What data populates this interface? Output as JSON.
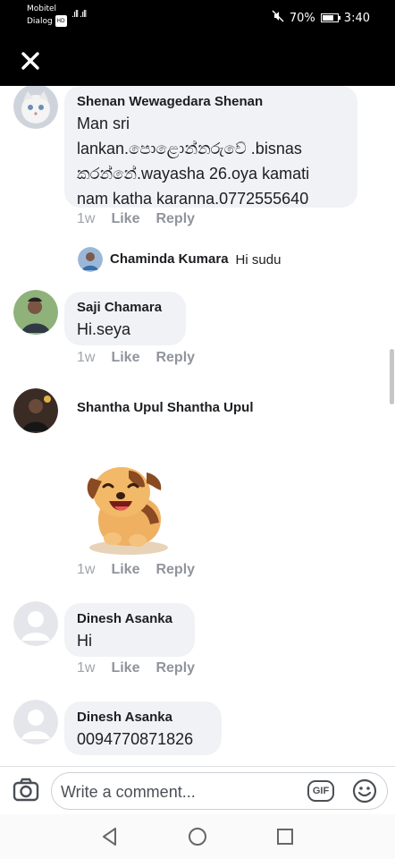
{
  "status_bar": {
    "carrier_1": "Mobitel",
    "carrier_2": "Dialog",
    "battery": "70%",
    "time": "3:40"
  },
  "comments": [
    {
      "author": "Shenan Wewagedara Shenan",
      "lines": [
        "Man sri",
        "lankan.පොළොන්නරුවේ .bisnas",
        "කරන්නේ.wayasha 26.oya kamati",
        "nam katha karanna.0772555640"
      ],
      "time": "1w",
      "like": "Like",
      "reply": "Reply"
    },
    {
      "author": "Chaminda Kumara",
      "text": "Hi sudu"
    },
    {
      "author": "Saji Chamara",
      "text": "Hi.seya",
      "time": "1w",
      "like": "Like",
      "reply": "Reply"
    },
    {
      "author": "Shantha Upul Shantha Upul",
      "sticker": "smiling-puppy-sticker",
      "time": "1w",
      "like": "Like",
      "reply": "Reply"
    },
    {
      "author": "Dinesh Asanka",
      "text": "Hi",
      "time": "1w",
      "like": "Like",
      "reply": "Reply"
    },
    {
      "author": "Dinesh Asanka",
      "text": "0094770871826"
    }
  ],
  "composer": {
    "placeholder": "Write a comment...",
    "gif": "GIF"
  },
  "icons": [
    "close-icon",
    "camera-icon",
    "emoji-icon",
    "back-icon",
    "home-icon",
    "recents-icon"
  ]
}
